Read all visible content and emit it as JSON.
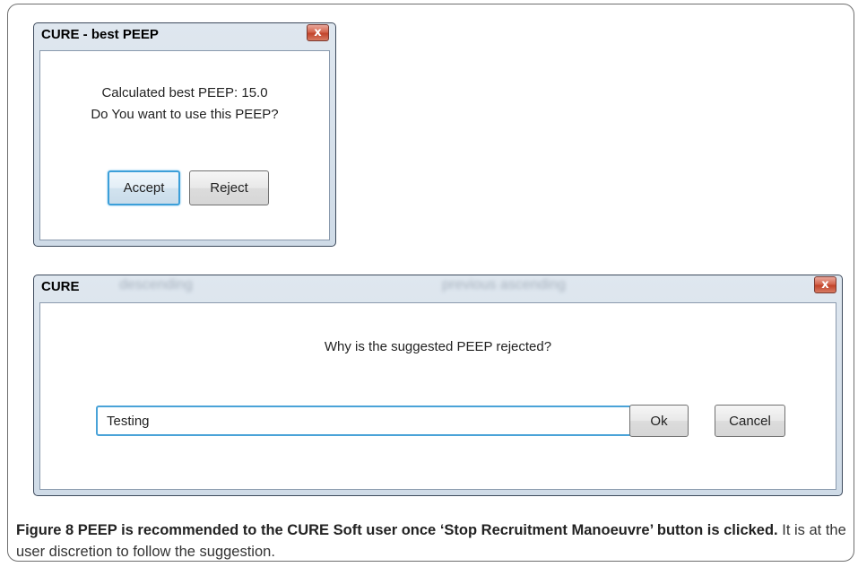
{
  "dialog1": {
    "title": "CURE - best PEEP",
    "close_glyph": "x",
    "message_line1": "Calculated best PEEP: 15.0",
    "message_line2": "Do You want to use this PEEP?",
    "accept_label": "Accept",
    "reject_label": "Reject"
  },
  "dialog2": {
    "title": "CURE",
    "close_glyph": "x",
    "ghost_text_left": "descending",
    "ghost_text_right": "previous ascending",
    "question": "Why is the suggested PEEP rejected?",
    "input_value": "Testing",
    "ok_label": "Ok",
    "cancel_label": "Cancel"
  },
  "caption": {
    "label": "Figure 8",
    "bold_text": "PEEP is recommended to the CURE Soft user once ‘Stop Recruitment Manoeuvre’ button is clicked.",
    "normal_text": "It is at the user discretion to follow the suggestion."
  },
  "colors": {
    "focus_blue": "#3c9fd9",
    "close_red": "#c2432a",
    "window_frame": "#cfdbe7"
  }
}
